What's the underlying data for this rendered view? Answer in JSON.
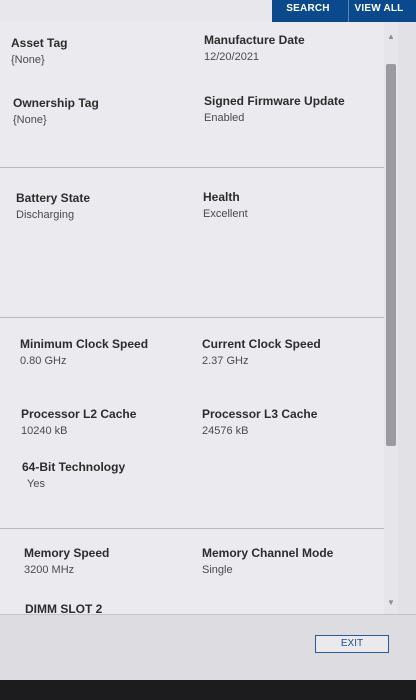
{
  "header": {
    "search_label": "SEARCH",
    "view_all_label": "VIEW ALL"
  },
  "fields": {
    "asset_tag": {
      "label": "Asset Tag",
      "value": "{None}"
    },
    "manufacture_date": {
      "label": "Manufacture Date",
      "value": "12/20/2021"
    },
    "ownership_tag": {
      "label": "Ownership Tag",
      "value": "{None}"
    },
    "signed_firmware_update": {
      "label": "Signed Firmware Update",
      "value": "Enabled"
    },
    "battery_state": {
      "label": "Battery State",
      "value": "Discharging"
    },
    "health": {
      "label": "Health",
      "value": "Excellent"
    },
    "min_clock_speed": {
      "label": "Minimum Clock Speed",
      "value": "0.80 GHz"
    },
    "current_clock_speed": {
      "label": "Current Clock Speed",
      "value": "2.37 GHz"
    },
    "l2_cache": {
      "label": "Processor L2 Cache",
      "value": "10240 kB"
    },
    "l3_cache": {
      "label": "Processor L3 Cache",
      "value": "24576 kB"
    },
    "tech_64bit": {
      "label": "64-Bit Technology",
      "value": "Yes"
    },
    "memory_speed": {
      "label": "Memory Speed",
      "value": "3200 MHz"
    },
    "memory_channel_mode": {
      "label": "Memory Channel Mode",
      "value": "Single"
    },
    "dimm_slot_2": {
      "label": "DIMM SLOT 2"
    }
  },
  "footer": {
    "exit_label": "EXIT"
  },
  "icons": {
    "scroll_up": "▲",
    "scroll_down": "▼"
  }
}
